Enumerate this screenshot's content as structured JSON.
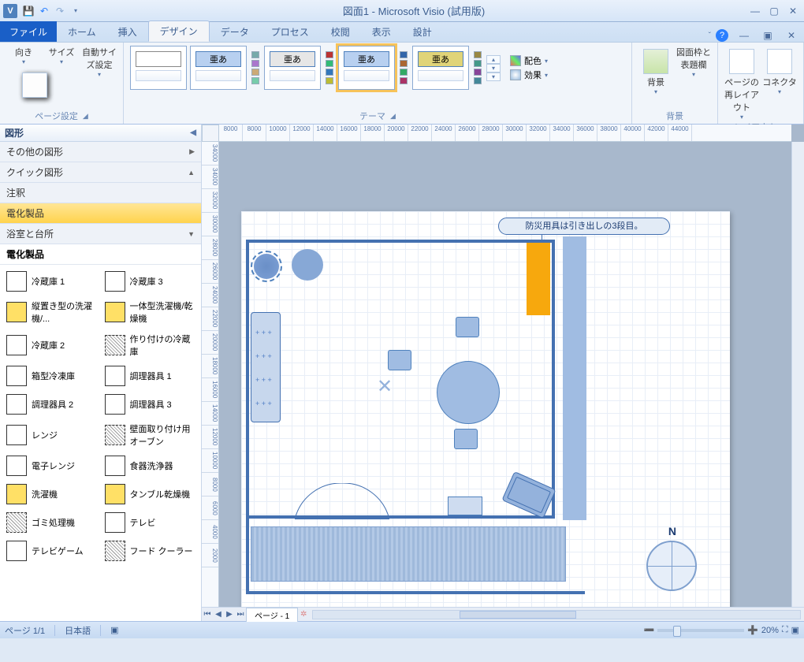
{
  "titlebar": {
    "title": "図面1 - Microsoft Visio (試用版)"
  },
  "ribbon": {
    "file": "ファイル",
    "tabs": [
      "ホーム",
      "挿入",
      "デザイン",
      "データ",
      "プロセス",
      "校閲",
      "表示",
      "設計"
    ],
    "active_index": 2,
    "groups": {
      "page_setup": {
        "label": "ページ設定",
        "orient": "向き",
        "size": "サイズ",
        "autosize": "自動サイズ設定"
      },
      "themes": {
        "label": "テーマ",
        "sample": "亜あ",
        "colors": "配色",
        "effects": "効果"
      },
      "background": {
        "label": "背景",
        "bg": "背景",
        "borders": "図面枠と表題欄"
      },
      "layout": {
        "label": "レイアウト",
        "relayout": "ページの再レイアウト",
        "connectors": "コネクタ"
      }
    }
  },
  "shapes": {
    "header": "図形",
    "other": "その他の図形",
    "quick": "クイック図形",
    "categories": [
      "注釈",
      "電化製品",
      "浴室と台所"
    ],
    "selected_cat": "電化製品",
    "items": [
      {
        "label": "冷蔵庫 1",
        "cls": ""
      },
      {
        "label": "冷蔵庫 3",
        "cls": ""
      },
      {
        "label": "縦置き型の洗濯機/...",
        "cls": "y"
      },
      {
        "label": "一体型洗濯機/乾燥機",
        "cls": "y"
      },
      {
        "label": "冷蔵庫 2",
        "cls": ""
      },
      {
        "label": "作り付けの冷蔵庫",
        "cls": "hatch"
      },
      {
        "label": "箱型冷凍庫",
        "cls": ""
      },
      {
        "label": "調理器具 1",
        "cls": ""
      },
      {
        "label": "調理器具 2",
        "cls": ""
      },
      {
        "label": "調理器具 3",
        "cls": ""
      },
      {
        "label": "レンジ",
        "cls": ""
      },
      {
        "label": "壁面取り付け用オーブン",
        "cls": "hatch"
      },
      {
        "label": "電子レンジ",
        "cls": ""
      },
      {
        "label": "食器洗浄器",
        "cls": ""
      },
      {
        "label": "洗濯機",
        "cls": "y"
      },
      {
        "label": "タンブル乾燥機",
        "cls": "y"
      },
      {
        "label": "ゴミ処理機",
        "cls": "hatch"
      },
      {
        "label": "テレビ",
        "cls": ""
      },
      {
        "label": "テレビゲーム",
        "cls": ""
      },
      {
        "label": "フード クーラー",
        "cls": "hatch"
      }
    ]
  },
  "ruler_h": [
    "8000",
    "8000",
    "10000",
    "12000",
    "14000",
    "16000",
    "18000",
    "20000",
    "22000",
    "24000",
    "26000",
    "28000",
    "30000",
    "32000",
    "34000",
    "36000",
    "38000",
    "40000",
    "42000",
    "44000"
  ],
  "ruler_v": [
    "34000",
    "34000",
    "32000",
    "30000",
    "28000",
    "26000",
    "24000",
    "22000",
    "20000",
    "18000",
    "16000",
    "14000",
    "12000",
    "10000",
    "8000",
    "6000",
    "4000",
    "2000"
  ],
  "canvas": {
    "callout": "防災用具は引き出しの3段目。",
    "compass_n": "N",
    "page_tab": "ページ - 1"
  },
  "statusbar": {
    "page": "ページ 1/1",
    "lang": "日本語",
    "zoom": "20%"
  }
}
